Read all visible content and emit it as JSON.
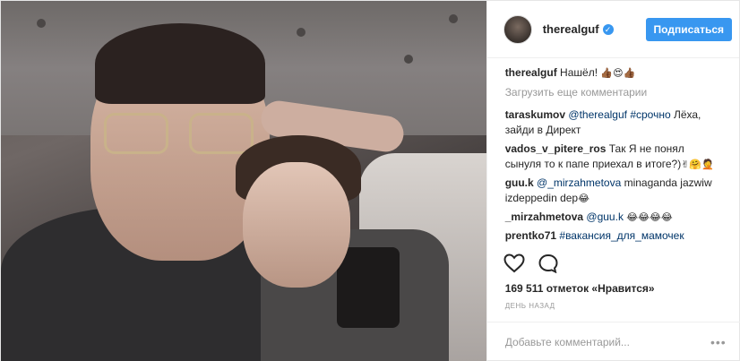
{
  "header": {
    "username": "therealguf",
    "verified_glyph": "✓",
    "follow_label": "Подписаться"
  },
  "caption": {
    "user": "therealguf",
    "text": "Нашёл!",
    "emoji": "👍🏾😍👍🏾"
  },
  "load_more": "Загрузить еще комментарии",
  "comments": [
    {
      "user": "taraskumov",
      "mention": "@therealguf",
      "tag": "#срочно",
      "text": " Лёха, зайди в Директ"
    },
    {
      "user": "vados_v_pitere_ros",
      "text": "Так Я не понял сынуля то к папе приехал в итоге?)",
      "emoji": "✌🤗🤦"
    },
    {
      "user": "guu.k",
      "mention": "@_mirzahmetova",
      "text": " minaganda jazwiw izdeppedin dep",
      "emoji": "😂"
    },
    {
      "user": "_mirzahmetova",
      "mention": "@guu.k",
      "emoji": "😂😂😂😂"
    },
    {
      "user": "prentko71",
      "tag": "#вакансия_для_мамочек"
    }
  ],
  "actions": {
    "like_icon": "heart-icon",
    "comment_icon": "comment-bubble-icon"
  },
  "likes": "169 511 отметок «Нравится»",
  "time": "день назад",
  "add_comment": {
    "placeholder": "Добавьте комментарий...",
    "more_glyph": "•••"
  }
}
